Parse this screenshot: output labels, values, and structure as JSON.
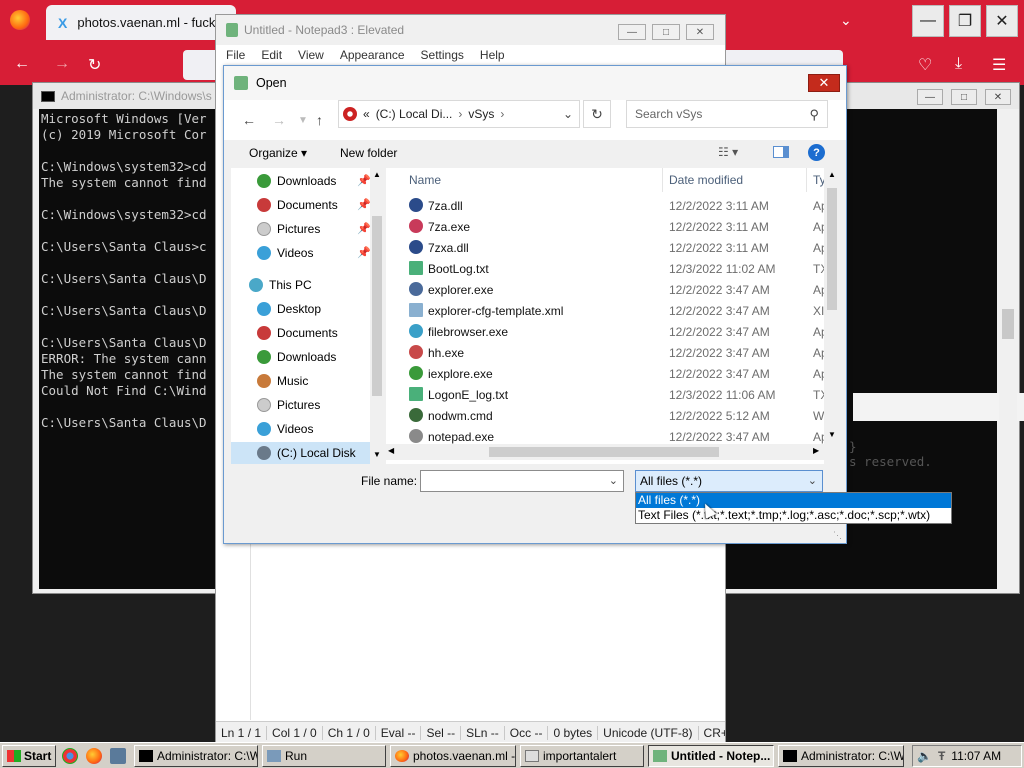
{
  "firefox": {
    "tab_title": "photos.vaenan.ml - fucky",
    "tab_favicon": "X"
  },
  "cmd": {
    "title": "Administrator: C:\\Windows\\s",
    "lines": "Microsoft Windows [Ver\n(c) 2019 Microsoft Cor\n\nC:\\Windows\\system32>cd\nThe system cannot find\n\nC:\\Windows\\system32>cd\n\nC:\\Users\\Santa Claus>c\n\nC:\\Users\\Santa Claus\\D\n\nC:\\Users\\Santa Claus\\D\n\nC:\\Users\\Santa Claus\\D\nERROR: The system cann\nThe system cannot find\nCould Not Find C:\\Wind\n\nC:\\Users\\Santa Claus\\D",
    "ghost_text": "}\ns reserved."
  },
  "notepad": {
    "title": "Untitled - Notepad3 : Elevated",
    "menu": [
      "File",
      "Edit",
      "View",
      "Appearance",
      "Settings",
      "Help"
    ],
    "status": [
      "Ln 1 / 1",
      "Col 1 / 0",
      "Ch 1 / 0",
      "Eval --",
      "Sel --",
      "SLn --",
      "Occ --",
      "0 bytes",
      "Unicode (UTF-8)",
      "CR+"
    ]
  },
  "dialog": {
    "title": "Open",
    "address": {
      "chevron": "«",
      "segment1": "(C:) Local Di...",
      "segment2": "vSys"
    },
    "search_placeholder": "Search vSys",
    "organize_label": "Organize ▾",
    "new_folder_label": "New folder",
    "nav_items": [
      {
        "label": "Downloads",
        "icon": "downloads-icon",
        "color": "#3a9a3a",
        "pinned": true
      },
      {
        "label": "Documents",
        "icon": "documents-icon",
        "color": "#c83a3a",
        "pinned": true
      },
      {
        "label": "Pictures",
        "icon": "pictures-icon",
        "color": "#cccccc",
        "pinned": true
      },
      {
        "label": "Videos",
        "icon": "videos-icon",
        "color": "#3aa0d8",
        "pinned": true
      },
      {
        "label": "This PC",
        "icon": "this-pc-icon",
        "color": "#4aa8c8",
        "pinned": false
      },
      {
        "label": "Desktop",
        "icon": "desktop-icon",
        "color": "#3aa0d8",
        "pinned": false
      },
      {
        "label": "Documents",
        "icon": "documents-icon",
        "color": "#c83a3a",
        "pinned": false
      },
      {
        "label": "Downloads",
        "icon": "downloads-icon",
        "color": "#3a9a3a",
        "pinned": false
      },
      {
        "label": "Music",
        "icon": "music-icon",
        "color": "#c87a3a",
        "pinned": false
      },
      {
        "label": "Pictures",
        "icon": "pictures-icon",
        "color": "#cccccc",
        "pinned": false
      },
      {
        "label": "Videos",
        "icon": "videos-icon",
        "color": "#3aa0d8",
        "pinned": false
      },
      {
        "label": "(C:) Local Disk",
        "icon": "local-disk-icon",
        "color": "#6a7a8a",
        "pinned": false
      }
    ],
    "columns": {
      "name": "Name",
      "date": "Date modified",
      "type": "Ty"
    },
    "files": [
      {
        "name": "7za.dll",
        "date": "12/2/2022 3:11 AM",
        "type": "Ap",
        "icon": "dll-icon",
        "color": "#2b4b8a"
      },
      {
        "name": "7za.exe",
        "date": "12/2/2022 3:11 AM",
        "type": "Ap",
        "icon": "exe-icon",
        "color": "#c83a5a"
      },
      {
        "name": "7zxa.dll",
        "date": "12/2/2022 3:11 AM",
        "type": "Ap",
        "icon": "dll-icon",
        "color": "#2b4b8a"
      },
      {
        "name": "BootLog.txt",
        "date": "12/3/2022 11:02 AM",
        "type": "TX",
        "icon": "txt-icon",
        "color": "#4ab07a"
      },
      {
        "name": "explorer.exe",
        "date": "12/2/2022 3:47 AM",
        "type": "Ap",
        "icon": "exe-icon",
        "color": "#4a6a9a"
      },
      {
        "name": "explorer-cfg-template.xml",
        "date": "12/2/2022 3:47 AM",
        "type": "XI",
        "icon": "xml-icon",
        "color": "#8ab0d0"
      },
      {
        "name": "filebrowser.exe",
        "date": "12/2/2022 3:47 AM",
        "type": "Ap",
        "icon": "exe-icon",
        "color": "#3aa0c8"
      },
      {
        "name": "hh.exe",
        "date": "12/2/2022 3:47 AM",
        "type": "Ap",
        "icon": "exe-icon",
        "color": "#c84a4a"
      },
      {
        "name": "iexplore.exe",
        "date": "12/2/2022 3:47 AM",
        "type": "Ap",
        "icon": "ie-icon",
        "color": "#3a9a3a"
      },
      {
        "name": "LogonE_log.txt",
        "date": "12/3/2022 11:06 AM",
        "type": "TX",
        "icon": "txt-icon",
        "color": "#4ab07a"
      },
      {
        "name": "nodwm.cmd",
        "date": "12/2/2022 5:12 AM",
        "type": "W",
        "icon": "cmd-file-icon",
        "color": "#3a6a3a"
      },
      {
        "name": "notepad.exe",
        "date": "12/2/2022 3:47 AM",
        "type": "Ap",
        "icon": "exe-icon",
        "color": "#8a8a8a"
      }
    ],
    "file_name_label": "File name:",
    "file_name_value": "",
    "file_type_selected": "All files (*.*)",
    "file_type_options": [
      "All files (*.*)",
      "Text Files (*.txt;*.text;*.tmp;*.log;*.asc;*.doc;*.scp;*.wtx)"
    ]
  },
  "taskbar": {
    "start_label": "Start",
    "buttons": [
      {
        "label": "Administrator: C:\\W...",
        "active": false
      },
      {
        "label": "Run",
        "active": false
      },
      {
        "label": "photos.vaenan.ml - ...",
        "active": false
      },
      {
        "label": "importantalert",
        "active": false
      },
      {
        "label": "Untitled - Notep...",
        "active": true
      },
      {
        "label": "Administrator: C:\\W...",
        "active": false
      }
    ],
    "clock": "11:07 AM"
  }
}
